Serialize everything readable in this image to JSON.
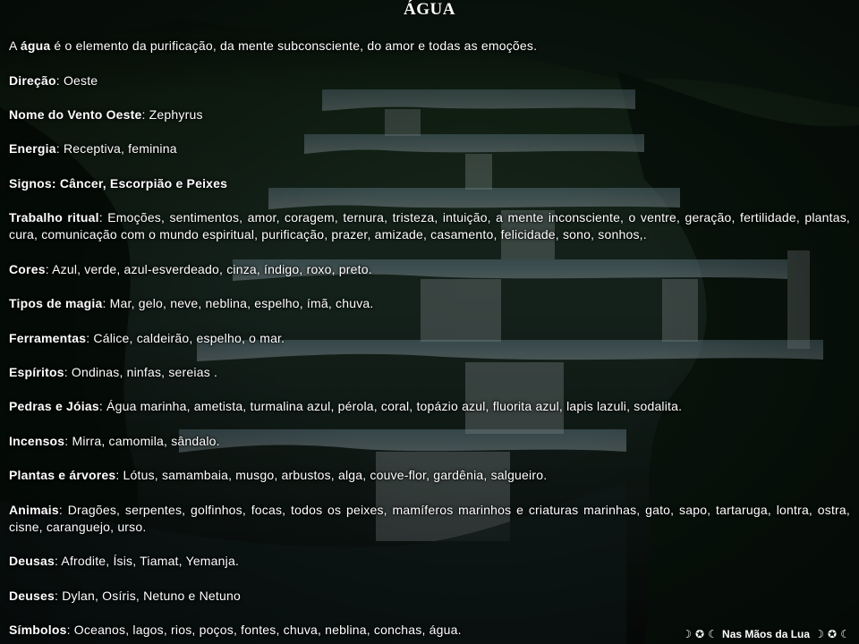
{
  "page": {
    "title": "ÁGUA",
    "intro": {
      "prefix": "A ",
      "bold": "água",
      "rest": " é o elemento da purificação, da mente subconsciente, do amor e todas as emoções."
    },
    "items": [
      {
        "label": "Direção",
        "value": ": Oeste"
      },
      {
        "label": "Nome do Vento Oeste",
        "value": ": Zephyrus"
      },
      {
        "label": "Energia",
        "value": ": Receptiva, feminina"
      },
      {
        "label": "Signos",
        "value": ": Câncer, Escorpião e Peixes"
      },
      {
        "label": "Trabalho ritual",
        "value": ": Emoções, sentimentos, amor, coragem, ternura, tristeza, intuição, a mente inconsciente, o ventre, geração, fertilidade, plantas, cura, comunicação com o mundo espiritual, purificação, prazer, amizade, casamento, felicidade, sono, sonhos,."
      },
      {
        "label": "Cores",
        "value": ": Azul, verde, azul-esverdeado, cinza, índigo, roxo, preto."
      },
      {
        "label": "Tipos de magia",
        "value": ": Mar, gelo, neve, neblina, espelho, ímã, chuva."
      },
      {
        "label": "Ferramentas",
        "value": ": Cálice, caldeirão, espelho, o mar."
      },
      {
        "label": "Espíritos",
        "value": ": Ondinas, ninfas, sereias ."
      },
      {
        "label": "Pedras e Jóias",
        "value": ":  Água marinha, ametista, turmalina azul, pérola, coral, topázio azul, fluorita azul, lapis lazuli, sodalita."
      },
      {
        "label": "Incensos",
        "value": ": Mirra, camomila, sândalo."
      },
      {
        "label": "Plantas e árvores",
        "value": ": Lótus, samambaia, musgo, arbustos, alga, couve-flor, gardênia, salgueiro."
      },
      {
        "label": "Animais",
        "value": ": Dragões, serpentes, golfinhos, focas, todos os peixes, mamíferos marinhos e criaturas marinhas, gato, sapo, tartaruga, lontra, ostra, cisne, caranguejo, urso."
      },
      {
        "label": "Deusas",
        "value": ": Afrodite, Ísis, Tiamat, Yemanja."
      },
      {
        "label": "Deuses",
        "value": ": Dylan, Osíris, Netuno e Netuno"
      },
      {
        "label": "Símbolos",
        "value": ": Oceanos, lagos, rios, poços, fontes, chuva, neblina, conchas, água."
      }
    ],
    "footer": {
      "left_glyphs": "☽ ✪ ☾",
      "text": "Nas Mãos da Lua",
      "right_glyphs": "☽ ✪ ☾"
    }
  }
}
